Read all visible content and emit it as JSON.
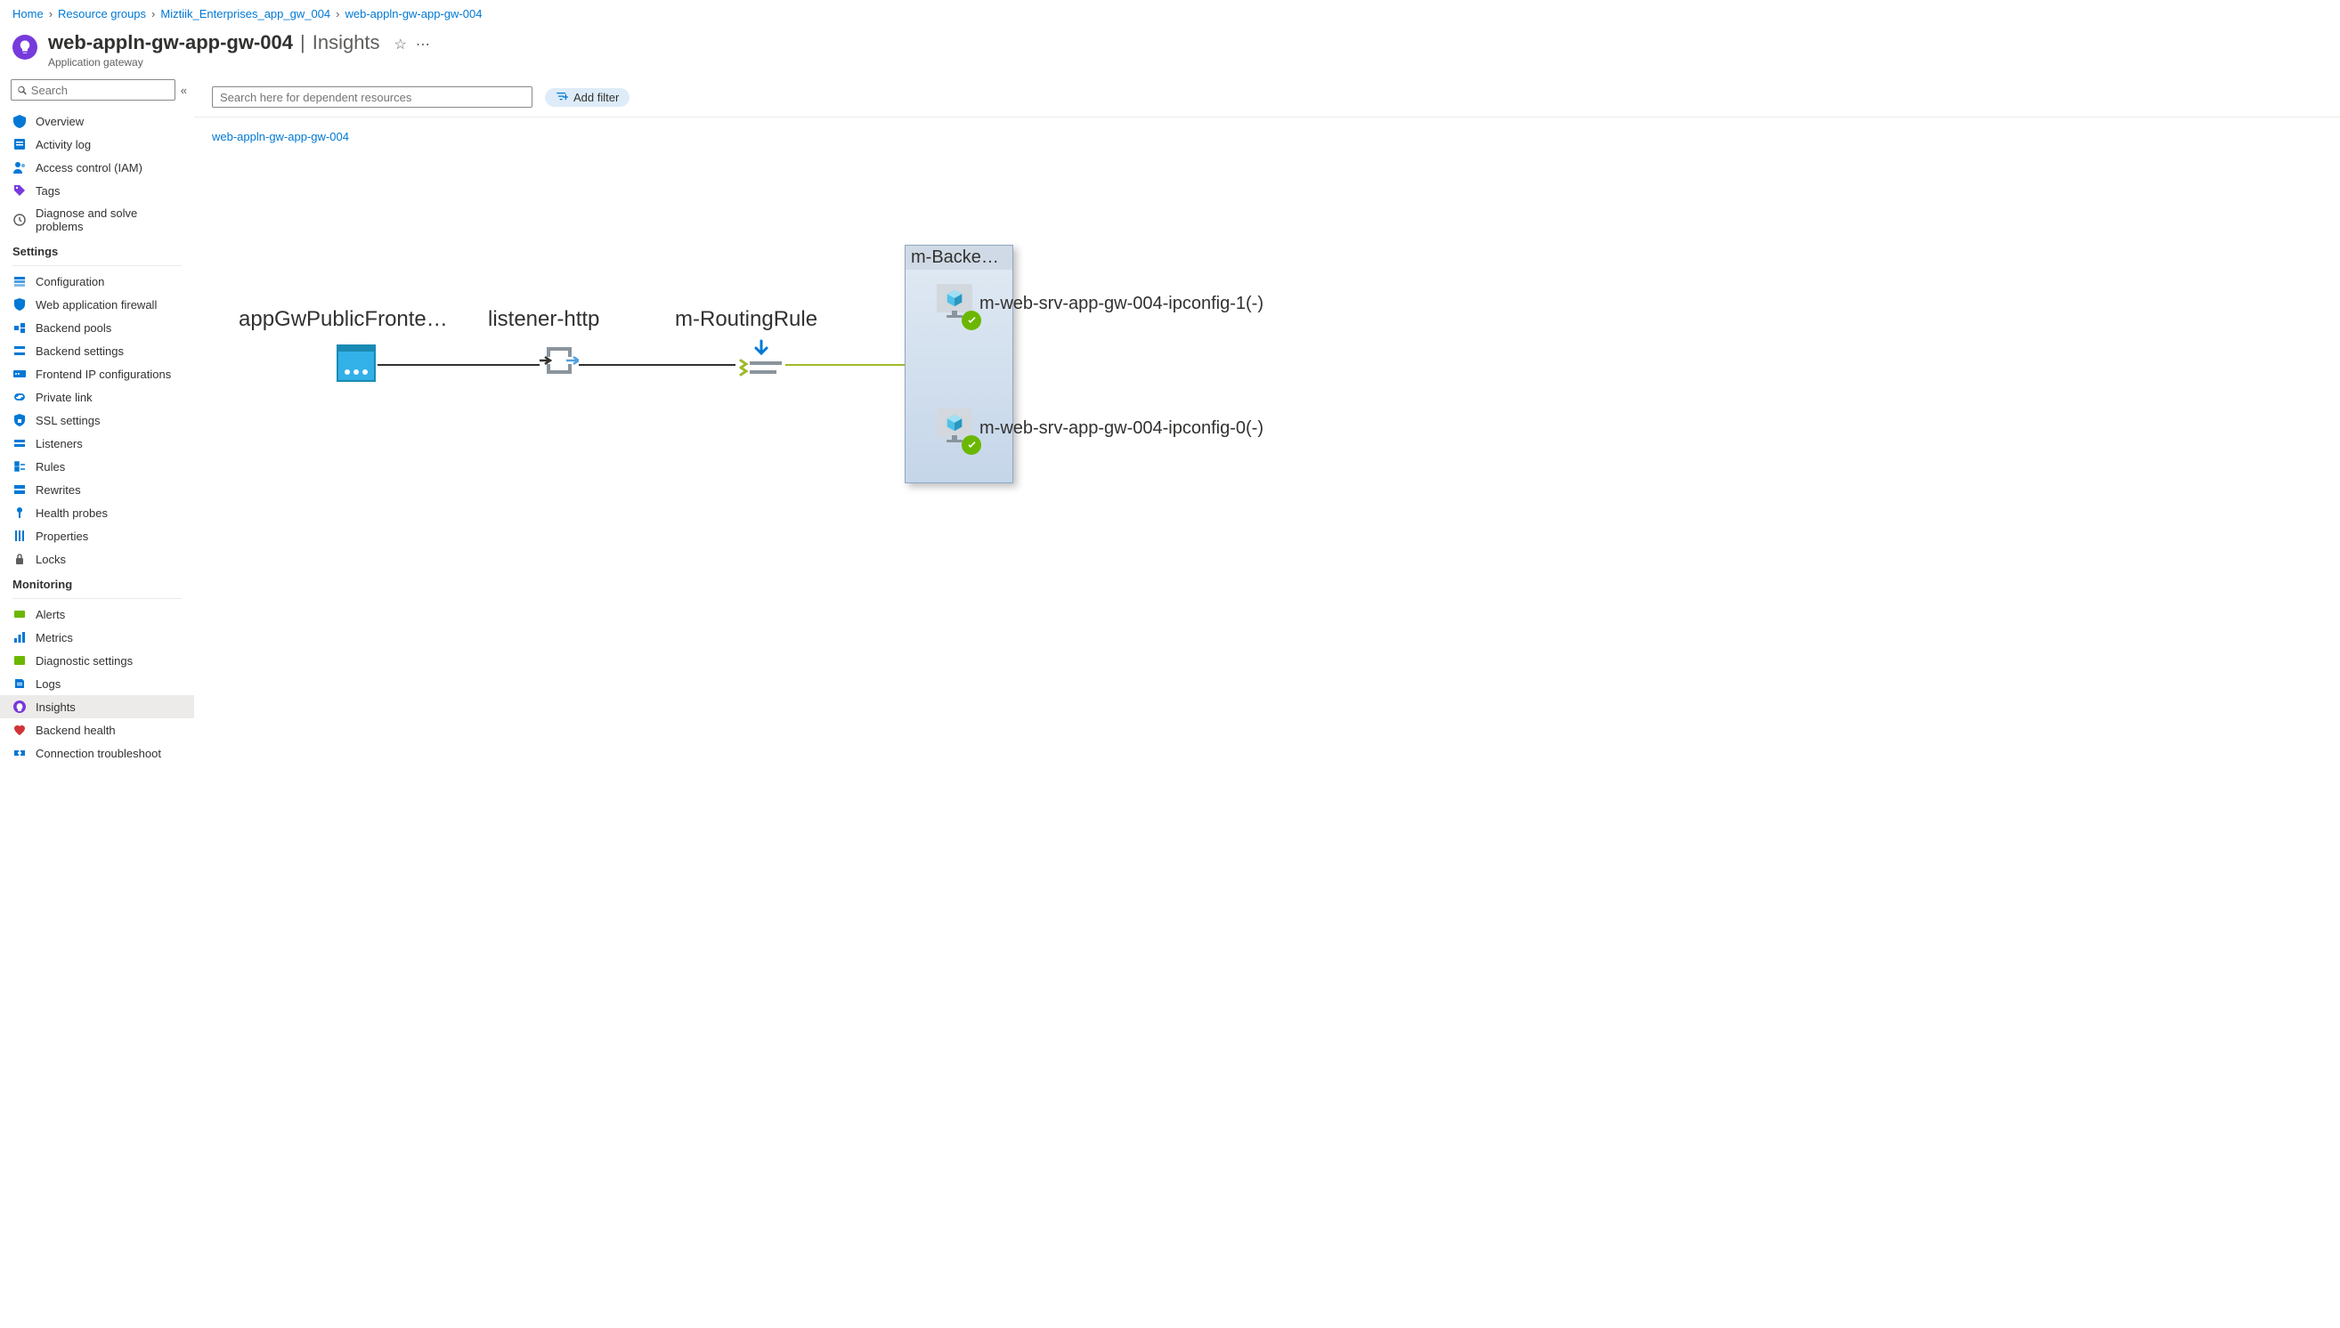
{
  "breadcrumb": {
    "home": "Home",
    "resource_groups": "Resource groups",
    "rg_name": "Miztiik_Enterprises_app_gw_004",
    "resource": "web-appln-gw-app-gw-004"
  },
  "header": {
    "title": "web-appln-gw-app-gw-004",
    "section": "Insights",
    "subtitle": "Application gateway"
  },
  "sidebar": {
    "search_placeholder": "Search",
    "top_items": [
      {
        "label": "Overview",
        "icon": "overview"
      },
      {
        "label": "Activity log",
        "icon": "activitylog"
      },
      {
        "label": "Access control (IAM)",
        "icon": "iam"
      },
      {
        "label": "Tags",
        "icon": "tags"
      },
      {
        "label": "Diagnose and solve problems",
        "icon": "diagnose"
      }
    ],
    "settings_heading": "Settings",
    "settings_items": [
      {
        "label": "Configuration",
        "icon": "config"
      },
      {
        "label": "Web application firewall",
        "icon": "waf"
      },
      {
        "label": "Backend pools",
        "icon": "backendpools"
      },
      {
        "label": "Backend settings",
        "icon": "backendsettings"
      },
      {
        "label": "Frontend IP configurations",
        "icon": "frontendip"
      },
      {
        "label": "Private link",
        "icon": "privatelink"
      },
      {
        "label": "SSL settings",
        "icon": "ssl"
      },
      {
        "label": "Listeners",
        "icon": "listeners"
      },
      {
        "label": "Rules",
        "icon": "rules"
      },
      {
        "label": "Rewrites",
        "icon": "rewrites"
      },
      {
        "label": "Health probes",
        "icon": "healthprobes"
      },
      {
        "label": "Properties",
        "icon": "properties"
      },
      {
        "label": "Locks",
        "icon": "locks"
      }
    ],
    "monitoring_heading": "Monitoring",
    "monitoring_items": [
      {
        "label": "Alerts",
        "icon": "alerts"
      },
      {
        "label": "Metrics",
        "icon": "metrics"
      },
      {
        "label": "Diagnostic settings",
        "icon": "diagsettings"
      },
      {
        "label": "Logs",
        "icon": "logs"
      },
      {
        "label": "Insights",
        "icon": "insights",
        "active": true
      },
      {
        "label": "Backend health",
        "icon": "backendhealth"
      },
      {
        "label": "Connection troubleshoot",
        "icon": "conntrouble"
      }
    ]
  },
  "toolbar": {
    "search_placeholder": "Search here for dependent resources",
    "add_filter": "Add filter"
  },
  "content": {
    "path_link": "web-appln-gw-app-gw-004"
  },
  "topology": {
    "frontend_label": "appGwPublicFronte…",
    "listener_label": "listener-http",
    "routing_label": "m-RoutingRule",
    "backend_pool_label": "m-Backen…",
    "vm1_label": "m-web-srv-app-gw-004-ipconfig-1(-)",
    "vm0_label": "m-web-srv-app-gw-004-ipconfig-0(-)"
  }
}
